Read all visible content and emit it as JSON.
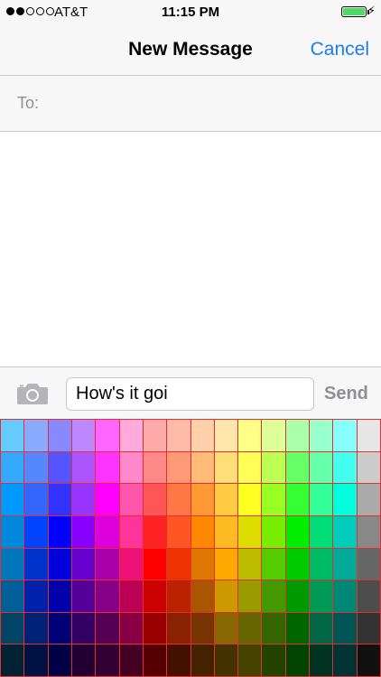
{
  "status_bar": {
    "signal_strength": 2,
    "signal_max": 5,
    "carrier": "AT&T",
    "time": "11:15 PM",
    "battery_level": 1.0,
    "charging_icon": "bolt-icon",
    "charging_glyph": "⚡"
  },
  "nav": {
    "title": "New Message",
    "cancel_label": "Cancel"
  },
  "recipient": {
    "label": "To:",
    "value": ""
  },
  "compose": {
    "camera_icon": "camera-icon",
    "message_value": "How's it goi",
    "send_label": "Send"
  },
  "palette": {
    "border_color": "#e03030",
    "rows": [
      [
        "#66ccff",
        "#88aaff",
        "#8888ff",
        "#bb88ff",
        "#ff66ff",
        "#ffaadd",
        "#ffaaaa",
        "#ffbbaa",
        "#ffd0aa",
        "#ffe6aa",
        "#ffff88",
        "#ddff99",
        "#aaffaa",
        "#99ffcc",
        "#88ffff",
        "#e6e6e6"
      ],
      [
        "#33aaff",
        "#5588ff",
        "#5555ff",
        "#aa55ff",
        "#ff33ff",
        "#ff88cc",
        "#ff8888",
        "#ff9977",
        "#ffbb77",
        "#ffdd77",
        "#ffff55",
        "#bbff55",
        "#66ff66",
        "#66ffaa",
        "#44ffee",
        "#cccccc"
      ],
      [
        "#0099ff",
        "#3366ff",
        "#3333ff",
        "#9933ff",
        "#ff00ff",
        "#ff55aa",
        "#ff5555",
        "#ff7744",
        "#ff9933",
        "#ffcc44",
        "#ffff22",
        "#99ff22",
        "#33ff33",
        "#33ff99",
        "#00ffdd",
        "#aaaaaa"
      ],
      [
        "#0088dd",
        "#0044ff",
        "#0000ff",
        "#8800ff",
        "#dd00dd",
        "#ff3399",
        "#ff2222",
        "#ff5522",
        "#ff8800",
        "#ffbb22",
        "#dddd00",
        "#77ee00",
        "#00ee00",
        "#00dd77",
        "#00ccbb",
        "#888888"
      ],
      [
        "#0077bb",
        "#0033cc",
        "#0000dd",
        "#6600cc",
        "#aa00aa",
        "#ee1177",
        "#ff0000",
        "#ee3300",
        "#dd7700",
        "#ffaa00",
        "#bbbb00",
        "#55cc00",
        "#00cc00",
        "#00bb66",
        "#00aa99",
        "#666666"
      ],
      [
        "#005f99",
        "#0022aa",
        "#0000aa",
        "#550099",
        "#880088",
        "#bb0055",
        "#cc0000",
        "#bb2200",
        "#aa5500",
        "#cc9900",
        "#999900",
        "#449900",
        "#009900",
        "#009955",
        "#008877",
        "#4d4d4d"
      ],
      [
        "#004466",
        "#002277",
        "#000077",
        "#330066",
        "#550055",
        "#880044",
        "#990000",
        "#882200",
        "#773300",
        "#886600",
        "#666600",
        "#336600",
        "#006600",
        "#006644",
        "#005555",
        "#333333"
      ],
      [
        "#002233",
        "#001144",
        "#000044",
        "#220033",
        "#330033",
        "#440022",
        "#550000",
        "#441100",
        "#442200",
        "#443300",
        "#444400",
        "#224400",
        "#004400",
        "#003322",
        "#003333",
        "#111111"
      ]
    ]
  }
}
